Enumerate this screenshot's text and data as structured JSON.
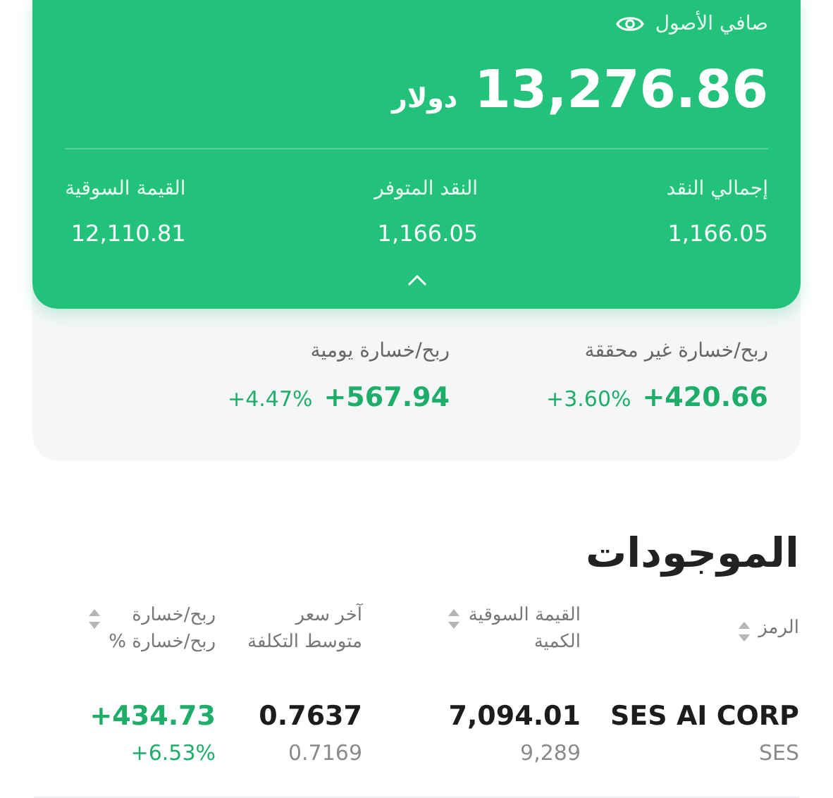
{
  "net_assets": {
    "label": "صافي الأصول",
    "value": "13,276.86",
    "currency": "دولار"
  },
  "summary": [
    {
      "label": "إجمالي النقد",
      "value": "1,166.05"
    },
    {
      "label": "النقد المتوفر",
      "value": "1,166.05"
    },
    {
      "label": "القيمة السوقية",
      "value": "12,110.81"
    }
  ],
  "expanded": true,
  "pnl": [
    {
      "label": "ربح/خسارة غير محققة",
      "value": "+420.66",
      "percent": "+3.60%"
    },
    {
      "label": "ربح/خسارة يومية",
      "value": "+567.94",
      "percent": "+4.47%"
    }
  ],
  "holdings": {
    "title": "الموجودات",
    "columns": [
      {
        "label": "الرمز",
        "sortable": true
      },
      {
        "label": "القيمة السوقية",
        "sublabel": "الكمية",
        "sortable": true
      },
      {
        "label": "آخر سعر",
        "sublabel": "متوسط التكلفة",
        "sortable": false
      },
      {
        "label": "ربح/خسارة",
        "sublabel": "ربح/خسارة %",
        "sortable": true
      }
    ],
    "rows": [
      {
        "name": "SES AI CORP",
        "symbol": "SES",
        "market_value": "7,094.01",
        "quantity": "9,289",
        "last_price": "0.7637",
        "avg_cost": "0.7169",
        "pnl": "+434.73",
        "pnl_percent": "+6.53%"
      }
    ]
  }
}
